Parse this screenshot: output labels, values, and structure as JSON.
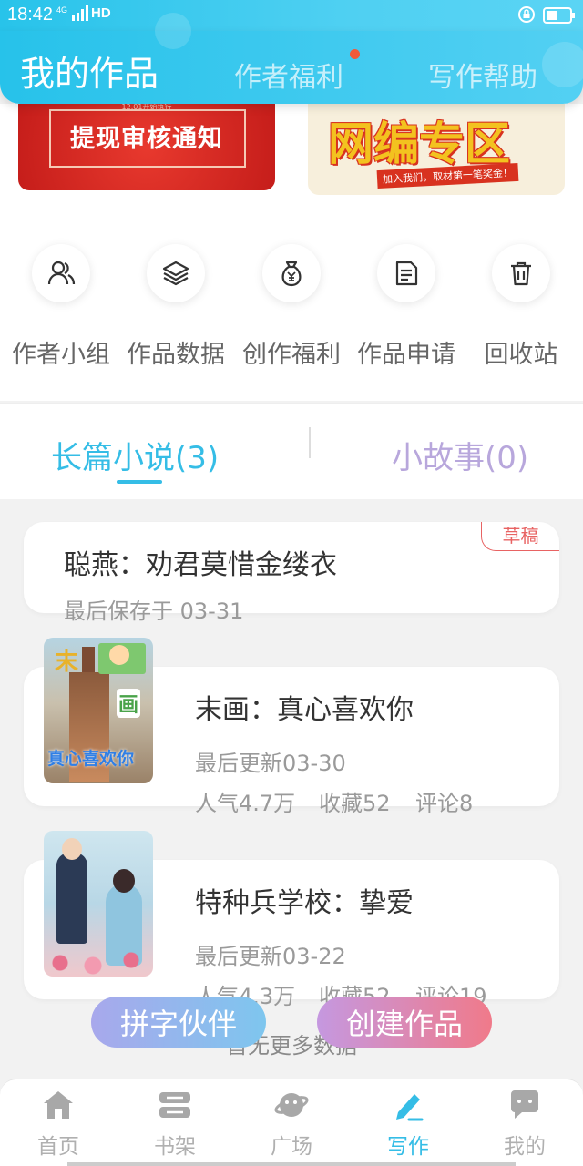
{
  "status_bar": {
    "time": "18:42",
    "network": "4G",
    "hd": "HD"
  },
  "header": {
    "title": "我的作品",
    "tabs": [
      "作者福利",
      "写作帮助"
    ]
  },
  "banners": {
    "left": {
      "text": "提现审核通知",
      "sub": "12.01开始执行"
    },
    "right": {
      "text": "网编专区",
      "slogan": "加入我们，取材第一笔奖金！"
    }
  },
  "quick_actions": [
    {
      "label": "作者小组",
      "icon": "author-group-icon"
    },
    {
      "label": "作品数据",
      "icon": "layers-icon"
    },
    {
      "label": "创作福利",
      "icon": "money-bag-icon"
    },
    {
      "label": "作品申请",
      "icon": "document-icon"
    },
    {
      "label": "回收站",
      "icon": "trash-icon"
    }
  ],
  "tabs": {
    "long_novel": "长篇小说(3)",
    "short_story": "小故事(0)"
  },
  "works": [
    {
      "title": "聪燕：劝君莫惜金缕衣",
      "badge": "草稿",
      "saved": "最后保存于 03-31"
    },
    {
      "title": "末画：真心喜欢你",
      "updated": "最后更新03-30",
      "popularity": "人气4.7万",
      "favorites": "收藏52",
      "comments": "评论8",
      "cover_text_top": "末",
      "cover_text_mid": "画",
      "cover_text_bottom": "真心喜欢你"
    },
    {
      "title": "特种兵学校：挚爱",
      "updated": "最后更新03-22",
      "popularity": "人气4.3万",
      "favorites": "收藏52",
      "comments": "评论19"
    }
  ],
  "no_more_text": "暂无更多数据",
  "floating_buttons": {
    "partner": "拼字伙伴",
    "create": "创建作品"
  },
  "bottom_nav": [
    {
      "label": "首页",
      "icon": "home-icon",
      "active": false
    },
    {
      "label": "书架",
      "icon": "bookshelf-icon",
      "active": false
    },
    {
      "label": "广场",
      "icon": "planet-icon",
      "active": false
    },
    {
      "label": "写作",
      "icon": "pen-icon",
      "active": true
    },
    {
      "label": "我的",
      "icon": "chat-bubble-icon",
      "active": false
    }
  ],
  "colors": {
    "accent": "#35bde6",
    "header_gradient_start": "#27c2ea",
    "draft_red": "#e86363",
    "short_story_purple": "#b8a7dc"
  }
}
